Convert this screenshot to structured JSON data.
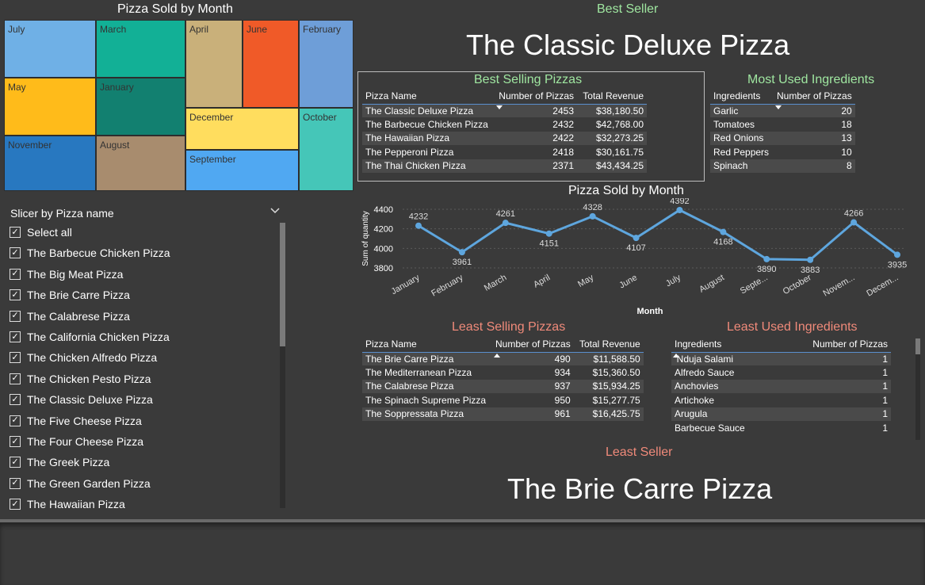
{
  "treemap": {
    "title": "Pizza Sold by Month",
    "cells": [
      {
        "label": "July",
        "color": "#6fb0e6"
      },
      {
        "label": "March",
        "color": "#12b096"
      },
      {
        "label": "April",
        "color": "#c9b07a"
      },
      {
        "label": "June",
        "color": "#f05a28"
      },
      {
        "label": "February",
        "color": "#6e9ed8"
      },
      {
        "label": "May",
        "color": "#ffbb1a"
      },
      {
        "label": "January",
        "color": "#128070"
      },
      {
        "label": "December",
        "color": "#ffdd5e"
      },
      {
        "label": "October",
        "color": "#45c6b8"
      },
      {
        "label": "November",
        "color": "#2878c0"
      },
      {
        "label": "August",
        "color": "#a88c6e"
      },
      {
        "label": "September",
        "color": "#50a8f2"
      }
    ]
  },
  "slicer": {
    "title": "Slicer by Pizza name",
    "items": [
      "Select all",
      "The Barbecue Chicken Pizza",
      "The Big Meat Pizza",
      "The Brie Carre Pizza",
      "The Calabrese Pizza",
      "The California Chicken Pizza",
      "The Chicken Alfredo Pizza",
      "The Chicken Pesto Pizza",
      "The Classic Deluxe Pizza",
      "The Five Cheese Pizza",
      "The Four Cheese Pizza",
      "The Greek Pizza",
      "The Green Garden Pizza",
      "The Hawaiian Pizza"
    ]
  },
  "best_seller": {
    "label": "Best Seller",
    "value": "The Classic Deluxe Pizza"
  },
  "least_seller": {
    "label": "Least Seller",
    "value": "The Brie Carre Pizza"
  },
  "best_selling": {
    "title": "Best Selling Pizzas",
    "headers": [
      "Pizza Name",
      "Number of Pizzas",
      "Total Revenue"
    ],
    "rows": [
      [
        "The Classic Deluxe Pizza",
        "2453",
        "$38,180.50"
      ],
      [
        "The Barbecue Chicken Pizza",
        "2432",
        "$42,768.00"
      ],
      [
        "The Hawaiian Pizza",
        "2422",
        "$32,273.25"
      ],
      [
        "The Pepperoni Pizza",
        "2418",
        "$30,161.75"
      ],
      [
        "The Thai Chicken Pizza",
        "2371",
        "$43,434.25"
      ]
    ]
  },
  "most_used": {
    "title": "Most Used Ingredients",
    "headers": [
      "Ingredients",
      "Number of Pizzas"
    ],
    "rows": [
      [
        "Garlic",
        "20"
      ],
      [
        "Tomatoes",
        "18"
      ],
      [
        "Red Onions",
        "13"
      ],
      [
        "Red Peppers",
        "10"
      ],
      [
        "Spinach",
        "8"
      ]
    ]
  },
  "least_selling": {
    "title": "Least Selling Pizzas",
    "headers": [
      "Pizza Name",
      "Number of Pizzas",
      "Total Revenue"
    ],
    "rows": [
      [
        "The Brie Carre Pizza",
        "490",
        "$11,588.50"
      ],
      [
        "The Mediterranean Pizza",
        "934",
        "$15,360.50"
      ],
      [
        "The Calabrese Pizza",
        "937",
        "$15,934.25"
      ],
      [
        "The Spinach Supreme Pizza",
        "950",
        "$15,277.75"
      ],
      [
        "The Soppressata Pizza",
        "961",
        "$16,425.75"
      ]
    ]
  },
  "least_used": {
    "title": "Least Used Ingredients",
    "headers": [
      "Ingredients",
      "Number of Pizzas"
    ],
    "rows": [
      [
        "‘Nduja Salami",
        "1"
      ],
      [
        "Alfredo Sauce",
        "1"
      ],
      [
        "Anchovies",
        "1"
      ],
      [
        "Artichoke",
        "1"
      ],
      [
        "Arugula",
        "1"
      ],
      [
        "Barbecue Sauce",
        "1"
      ]
    ]
  },
  "chart_data": {
    "type": "line",
    "title": "Pizza Sold by Month",
    "xlabel": "Month",
    "ylabel": "Sum of quantity",
    "categories": [
      "January",
      "February",
      "March",
      "April",
      "May",
      "June",
      "July",
      "August",
      "Septe...",
      "October",
      "Novem...",
      "Decem..."
    ],
    "values": [
      4232,
      3961,
      4261,
      4151,
      4328,
      4107,
      4392,
      4168,
      3890,
      3883,
      4266,
      3935
    ],
    "yticks": [
      3800,
      4000,
      4200,
      4400
    ],
    "ylim": [
      3800,
      4400
    ],
    "grid": true,
    "color": "#5ea6de"
  },
  "colors": {
    "background": "#3a3a3a",
    "accent_green": "#9fe6a0",
    "accent_salmon": "#f08a7a",
    "line": "#5ea6de"
  }
}
